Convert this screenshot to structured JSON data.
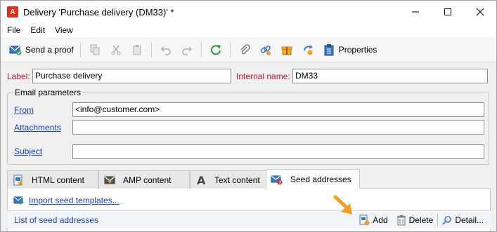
{
  "window": {
    "title": "Delivery 'Purchase delivery (DM33)' *"
  },
  "menu": [
    "File",
    "Edit",
    "View"
  ],
  "toolbar": {
    "send_proof": "Send a proof",
    "properties": "Properties"
  },
  "form": {
    "label_caption": "Label:",
    "label_value": "Purchase delivery",
    "internal_caption": "Internal name:",
    "internal_value": "DM33"
  },
  "email_params": {
    "group_title": "Email parameters",
    "from_link": "From",
    "from_value": "<info@customer.com>",
    "attachments_link": "Attachments",
    "subject_link": "Subject"
  },
  "tabs": [
    {
      "label": "HTML content",
      "icon": "html-content-icon"
    },
    {
      "label": "AMP content",
      "icon": "amp-content-icon"
    },
    {
      "label": "Text content",
      "icon": "text-content-icon"
    },
    {
      "label": "Seed addresses",
      "icon": "seed-addresses-icon",
      "active": true
    }
  ],
  "seed_panel": {
    "import_link": "Import seed templates...",
    "list_title": "List of seed addresses",
    "add": "Add",
    "delete": "Delete",
    "detail": "Detail..."
  },
  "colors": {
    "link": "#1a3fb8",
    "required_label": "#c8102e",
    "accent_orange": "#f0a020"
  }
}
